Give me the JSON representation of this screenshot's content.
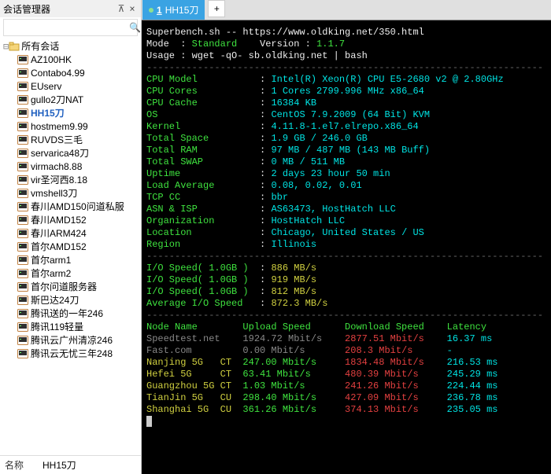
{
  "sidebar": {
    "title": "会话管理器",
    "filter_placeholder": "",
    "root_label": "所有会话",
    "items": [
      {
        "label": "AZ100HK",
        "active": false
      },
      {
        "label": "Contabo4.99",
        "active": false
      },
      {
        "label": "EUserv",
        "active": false
      },
      {
        "label": "gullo2刀NAT",
        "active": false
      },
      {
        "label": "HH15刀",
        "active": true
      },
      {
        "label": "hostmem9.99",
        "active": false
      },
      {
        "label": "RUVDS三毛",
        "active": false
      },
      {
        "label": "servarica48刀",
        "active": false
      },
      {
        "label": "virmach8.88",
        "active": false
      },
      {
        "label": "vir圣河西8.18",
        "active": false
      },
      {
        "label": "vmshell3刀",
        "active": false
      },
      {
        "label": "春川AMD150问道私服",
        "active": false
      },
      {
        "label": "春川AMD152",
        "active": false
      },
      {
        "label": "春川ARM424",
        "active": false
      },
      {
        "label": "首尔AMD152",
        "active": false
      },
      {
        "label": "首尔arm1",
        "active": false
      },
      {
        "label": "首尔arm2",
        "active": false
      },
      {
        "label": "首尔问道服务器",
        "active": false
      },
      {
        "label": "斯巴达24刀",
        "active": false
      },
      {
        "label": "腾讯送的一年246",
        "active": false
      },
      {
        "label": "腾讯119轻量",
        "active": false
      },
      {
        "label": "腾讯云广州清凉246",
        "active": false
      },
      {
        "label": "腾讯云无忧三年248",
        "active": false
      }
    ],
    "footer_label": "名称",
    "footer_value": "HH15刀"
  },
  "tab": {
    "num": "1",
    "label": "HH15刀"
  },
  "term": {
    "hdr1": "Superbench.sh -- https://www.oldking.net/350.html",
    "hdr2a": "Mode  : ",
    "hdr2b": "Standard",
    "hdr2c": "    Version : ",
    "hdr2d": "1.1.7",
    "hdr3": "Usage : wget -qO- sb.oldking.net | bash",
    "sys": [
      [
        "CPU Model",
        "Intel(R) Xeon(R) CPU E5-2680 v2 @ 2.80GHz"
      ],
      [
        "CPU Cores",
        "1 Cores 2799.996 MHz x86_64"
      ],
      [
        "CPU Cache",
        "16384 KB"
      ],
      [
        "OS",
        "CentOS 7.9.2009 (64 Bit) KVM"
      ],
      [
        "Kernel",
        "4.11.8-1.el7.elrepo.x86_64"
      ],
      [
        "Total Space",
        "1.9 GB / 246.0 GB"
      ],
      [
        "Total RAM",
        "97 MB / 487 MB (143 MB Buff)"
      ],
      [
        "Total SWAP",
        "0 MB / 511 MB"
      ],
      [
        "Uptime",
        "2 days 23 hour 50 min"
      ],
      [
        "Load Average",
        "0.08, 0.02, 0.01"
      ],
      [
        "TCP CC",
        "bbr"
      ],
      [
        "ASN & ISP",
        "AS63473, HostHatch LLC"
      ],
      [
        "Organization",
        "HostHatch LLC"
      ],
      [
        "Location",
        "Chicago, United States / US"
      ],
      [
        "Region",
        "Illinois"
      ]
    ],
    "io": [
      [
        "I/O Speed( 1.0GB )",
        "886 MB/s"
      ],
      [
        "I/O Speed( 1.0GB )",
        "919 MB/s"
      ],
      [
        "I/O Speed( 1.0GB )",
        "812 MB/s"
      ],
      [
        "Average I/O Speed",
        "872.3 MB/s"
      ]
    ],
    "speed_hdr": [
      "Node Name",
      "Upload Speed",
      "Download Speed",
      "Latency"
    ],
    "speed": [
      {
        "name": "Speedtest.net",
        "up": "1924.72 Mbit/s",
        "dn": "2877.51 Mbit/s",
        "lat": "16.37 ms",
        "dim": true
      },
      {
        "name": "Fast.com",
        "up": "0.00 Mbit/s",
        "dn": "208.3 Mbit/s",
        "lat": "-",
        "dim": true
      },
      {
        "name": "Nanjing 5G   CT",
        "up": "247.00 Mbit/s",
        "dn": "1834.48 Mbit/s",
        "lat": "216.53 ms",
        "dim": false
      },
      {
        "name": "Hefei 5G     CT",
        "up": "63.41 Mbit/s",
        "dn": "480.39 Mbit/s",
        "lat": "245.29 ms",
        "dim": false
      },
      {
        "name": "Guangzhou 5G CT",
        "up": "1.03 Mbit/s",
        "dn": "241.26 Mbit/s",
        "lat": "224.44 ms",
        "dim": false
      },
      {
        "name": "TianJin 5G   CU",
        "up": "298.40 Mbit/s",
        "dn": "427.09 Mbit/s",
        "lat": "236.78 ms",
        "dim": false
      },
      {
        "name": "Shanghai 5G  CU",
        "up": "361.26 Mbit/s",
        "dn": "374.13 Mbit/s",
        "lat": "235.05 ms",
        "dim": false
      }
    ],
    "sep": "----------------------------------------------------------------------"
  }
}
